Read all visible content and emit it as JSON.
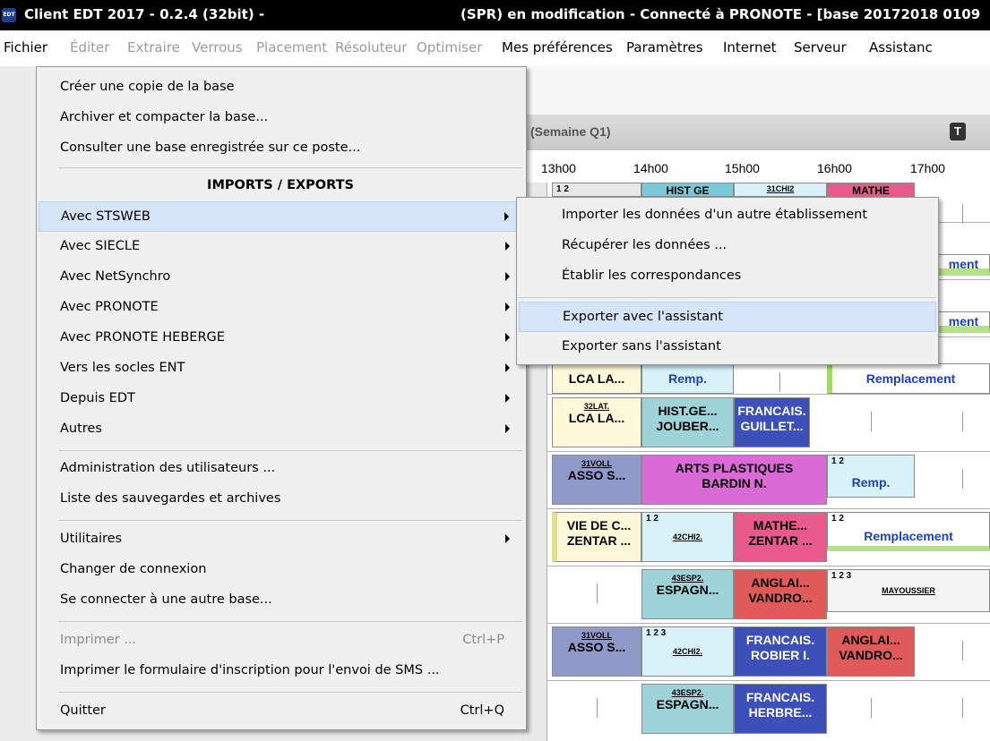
{
  "window": {
    "app_title": "Client EDT 2017 - 0.2.4 (32bit) -",
    "title_rest": "(SPR) en modification - Connecté à PRONOTE - [base 20172018 0109",
    "logo_text": "EDT"
  },
  "menubar": [
    {
      "label": "Fichier",
      "disabled": false
    },
    {
      "label": "Éditer",
      "disabled": true
    },
    {
      "label": "Extraire",
      "disabled": true
    },
    {
      "label": "Verrous",
      "disabled": true
    },
    {
      "label": "Placement",
      "disabled": true
    },
    {
      "label": "Résoluteur",
      "disabled": true
    },
    {
      "label": "Optimiser",
      "disabled": true
    },
    {
      "label": "Mes préférences",
      "disabled": false
    },
    {
      "label": "Paramètres",
      "disabled": false
    },
    {
      "label": "Internet",
      "disabled": false
    },
    {
      "label": "Serveur",
      "disabled": false
    },
    {
      "label": "Assistanc",
      "disabled": false
    }
  ],
  "panel": {
    "week_label": "(Semaine Q1)",
    "tx_icon": "T"
  },
  "time_axis": [
    "13h00",
    "14h00",
    "15h00",
    "16h00",
    "17h00"
  ],
  "file_menu": {
    "items": [
      {
        "label": "Créer une copie de la base"
      },
      {
        "label": "Archiver et compacter la base..."
      },
      {
        "label": "Consulter une base enregistrée sur ce poste..."
      },
      {
        "label": "IMPORTS / EXPORTS",
        "header": true
      },
      {
        "label": "Avec STSWEB",
        "submenu": true,
        "highlighted": true
      },
      {
        "label": "Avec SIECLE",
        "submenu": true
      },
      {
        "label": "Avec NetSynchro",
        "submenu": true
      },
      {
        "label": "Avec PRONOTE",
        "submenu": true
      },
      {
        "label": "Avec PRONOTE HEBERGE",
        "submenu": true
      },
      {
        "label": "Vers les socles ENT",
        "submenu": true
      },
      {
        "label": "Depuis EDT",
        "submenu": true
      },
      {
        "label": "Autres",
        "submenu": true
      },
      {
        "label": "Administration des utilisateurs ..."
      },
      {
        "label": "Liste des sauvegardes et archives"
      },
      {
        "label": "Utilitaires",
        "submenu": true
      },
      {
        "label": "Changer de connexion"
      },
      {
        "label": "Se connecter à une autre base..."
      },
      {
        "label": "Imprimer ...",
        "shortcut": "Ctrl+P",
        "disabled": true
      },
      {
        "label": "Imprimer le formulaire d'inscription pour l'envoi de SMS ..."
      },
      {
        "label": "Quitter",
        "shortcut": "Ctrl+Q"
      }
    ]
  },
  "submenu": {
    "items": [
      {
        "label": "Importer les données d'un autre établissement"
      },
      {
        "label": "Récupérer les données ..."
      },
      {
        "label": "Établir les correspondances"
      },
      {
        "label": "Exporter avec l'assistant",
        "highlighted": true
      },
      {
        "label": "Exporter sans l'assistant"
      }
    ]
  },
  "timetable": {
    "row1": {
      "nums": "1 2",
      "hist": "HIST GE",
      "chi": "31CHI2",
      "mathe": "MATHE"
    },
    "row_ment_a": "ment",
    "row_ment_b": "ment",
    "row3": {
      "lca": "LCA LA...",
      "remp": "Remp.",
      "remplacement": "Remplacement"
    },
    "row4": {
      "lat": "32LAT.",
      "lca": "LCA LA...",
      "hist1": "HIST.GE...",
      "hist2": "JOUBER...",
      "fr1": "FRANCAIS.",
      "fr2": "GUILLET..."
    },
    "row5": {
      "voll": "31VOLL",
      "asso": "ASSO S...",
      "arts1": "ARTS PLASTIQUES",
      "arts2": "BARDIN N.",
      "nums": "1 2",
      "remp": "Remp."
    },
    "row6": {
      "vie1": "VIE DE C...",
      "vie2": "ZENTAR ...",
      "nums": "1 2",
      "chi": "42CHI2.",
      "math1": "MATHE...",
      "math2": "ZENTAR ...",
      "nums2": "1 2",
      "remplacement": "Remplacement"
    },
    "row7": {
      "esp": "43ESP2.",
      "esp2": "ESPAGN...",
      "ang1": "ANGLAI...",
      "ang2": "VANDRO...",
      "nums": "1 2 3",
      "mayou": "MAYOUSSIER"
    },
    "row8": {
      "voll": "31VOLL",
      "asso": "ASSO S...",
      "nums": "1 2 3",
      "chi": "42CHI2.",
      "fr1": "FRANCAIS.",
      "fr2": "ROBIER I.",
      "ang1": "ANGLAI...",
      "ang2": "VANDRO..."
    },
    "row9": {
      "esp": "43ESP2.",
      "esp2": "ESPAGN...",
      "fr1": "FRANCAIS.",
      "fr2": "HERBRE..."
    }
  }
}
